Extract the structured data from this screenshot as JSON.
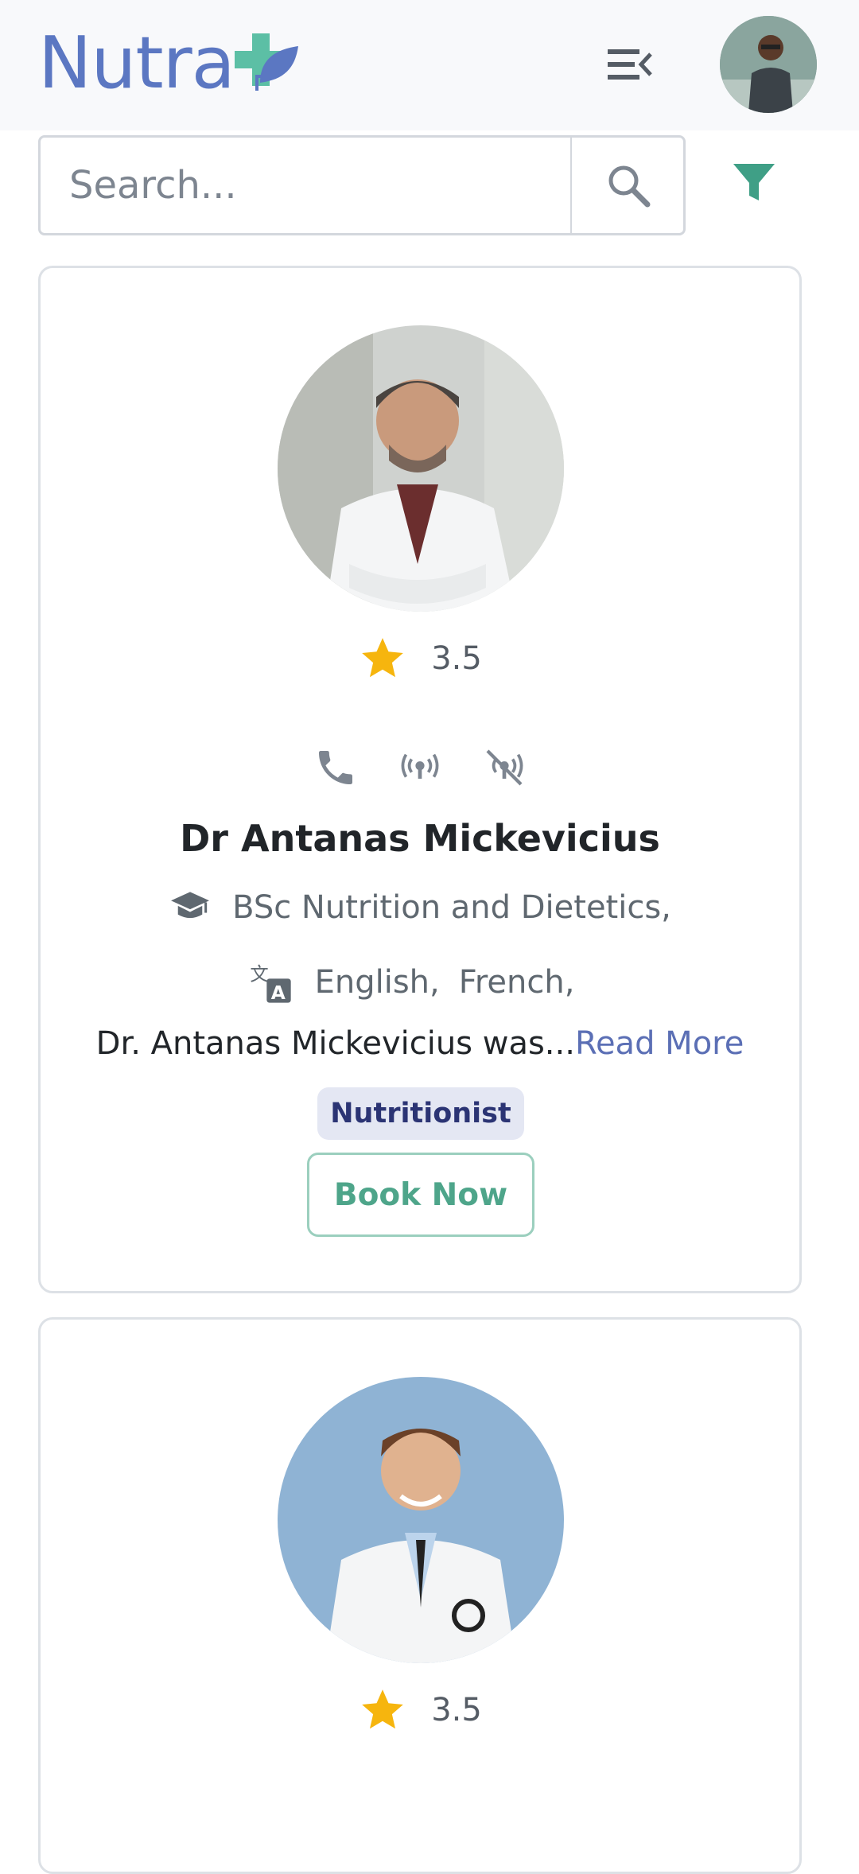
{
  "header": {
    "logo_text": "Nutra",
    "accent_color": "#4ea58a",
    "brand_color": "#5b77c2"
  },
  "search": {
    "placeholder": "Search..."
  },
  "doctors": [
    {
      "rating": "3.5",
      "name": "Dr Antanas Mickevicius",
      "qualification": "BSc Nutrition and Dietetics,",
      "languages": [
        "English,",
        "French,"
      ],
      "bio": "Dr. Antanas Mickevicius was...",
      "read_more": "Read More",
      "specialty": "Nutritionist",
      "book_label": "Book Now"
    },
    {
      "rating": "3.5"
    }
  ]
}
